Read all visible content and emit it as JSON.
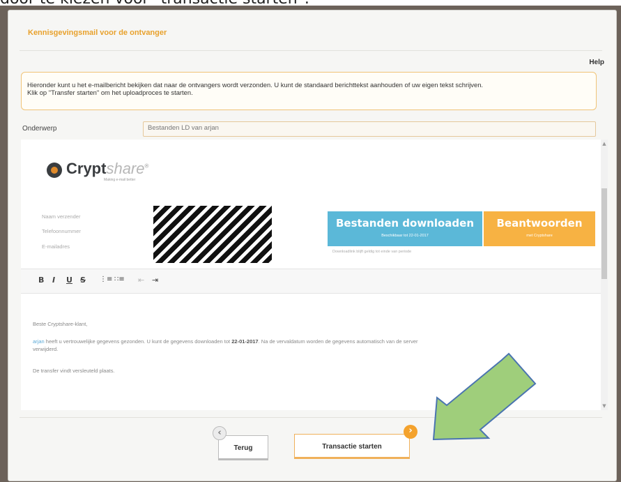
{
  "caption": "door te kiezen voor \"transactie starten\".",
  "dialog": {
    "title": "Kennisgevingsmail voor de ontvanger",
    "help_label": "Help",
    "info_line1": "Hieronder kunt u het e-mailbericht bekijken dat naar de ontvangers wordt verzonden. U kunt de standaard berichttekst aanhouden of uw eigen tekst schrijven.",
    "info_line2": "Klik op \"Transfer starten\" om het uploadproces te starten.",
    "subject_label": "Onderwerp",
    "subject_value": "Bestanden LD van arjan"
  },
  "preview": {
    "logo_main": "Crypt",
    "logo_thin": "share",
    "logo_mark": "®",
    "logo_tagline": "Making e-mail better",
    "meta_labels": [
      "Naam verzender",
      "Telefoonnummer",
      "E-mailadres"
    ],
    "download_button": "Bestanden downloaden",
    "download_sub": "Beschikbaar tot 22-01-2017",
    "reply_button": "Beantwoorden",
    "reply_sub": "met Cryptshare",
    "valid_note": "Downloadlink blijft geldig tot einde van periode"
  },
  "toolbar": {
    "bold": "B",
    "italic": "I",
    "underline": "U",
    "strike": "S",
    "ordered_list": "⋮≡",
    "unordered_list": "∷≡",
    "outdent": "⇤",
    "indent": "⇥"
  },
  "body": {
    "greeting": "Beste Cryptshare-klant,",
    "sender_link": "arjan",
    "line_part1": "heeft u vertrouwelijke gegevens gezonden. U kunt de gegevens downloaden tot",
    "expiry_date": "22-01-2017",
    "line_part2": ". Na de vervaldatum worden de gegevens automatisch van de server",
    "line_part3": "verwijderd.",
    "closing": "De transfer vindt versleuteld plaats."
  },
  "nav": {
    "back_label": "Terug",
    "back_icon": "‹",
    "start_label": "Transactie starten",
    "start_icon": "›"
  },
  "colors": {
    "accent_orange": "#e8a12c",
    "download_blue": "#5bb8d8",
    "reply_orange": "#f7b243",
    "arrow_green": "#9fce7b",
    "arrow_stroke": "#4a74b0"
  }
}
